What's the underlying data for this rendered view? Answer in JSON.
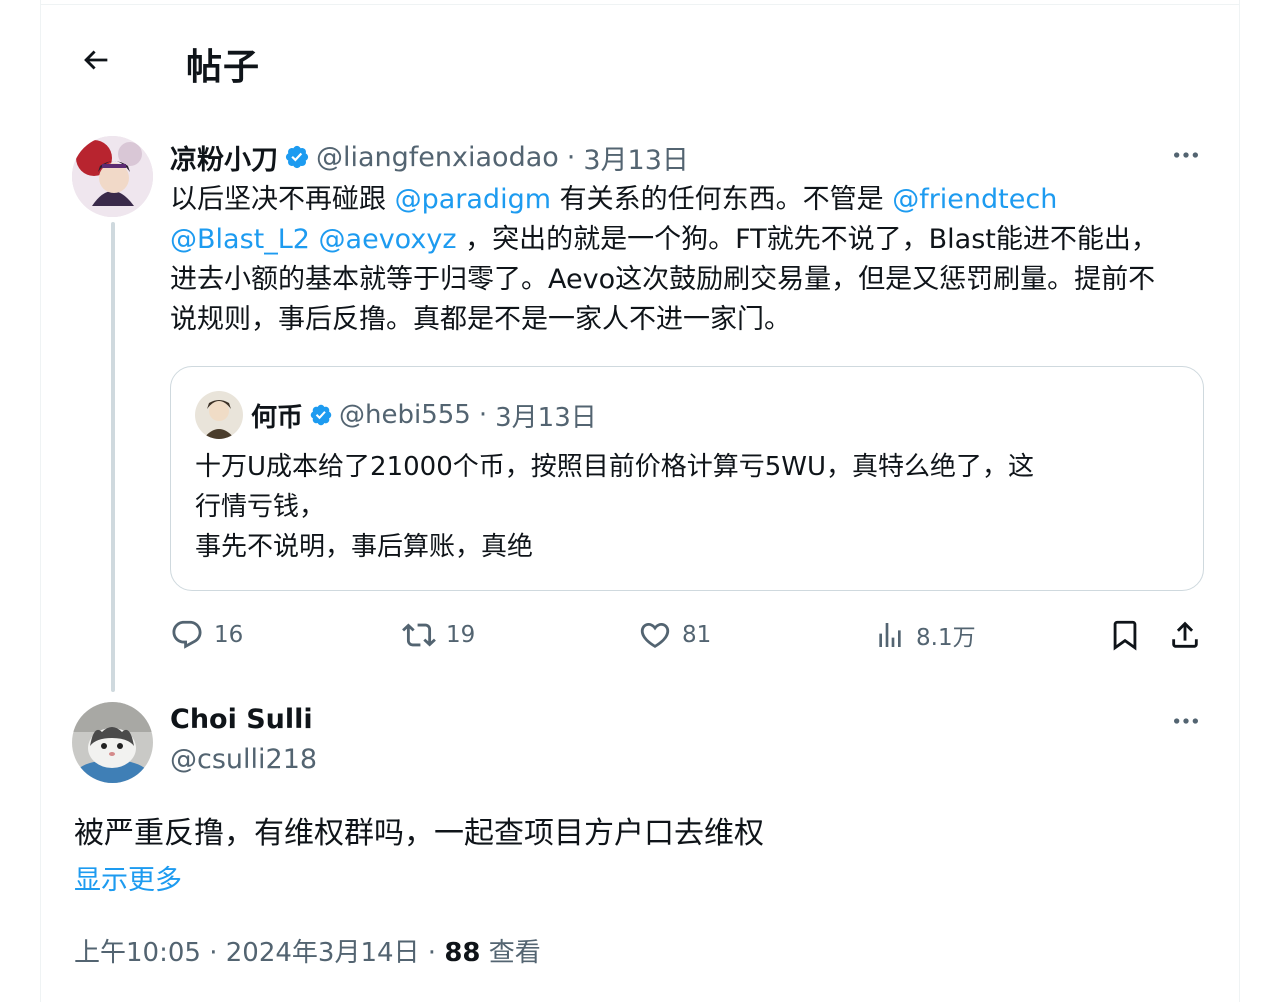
{
  "header": {
    "title": "帖子"
  },
  "post": {
    "author_name": "凉粉小刀",
    "handle": "@liangfenxiaodao",
    "separator": "·",
    "date": "3月13日",
    "segments": {
      "s1": "以后坚决不再碰跟 ",
      "m1": "@paradigm",
      "s2": " 有关系的任何东西。不管是 ",
      "m2": "@friendtech",
      "m3": "@Blast_L2",
      "s3": " ",
      "m4": "@aevoxyz",
      "s4": " ，突出的就是一个狗。FT就先不说了，Blast能进不能出，进去小额的基本就等于归零了。Aevo这次鼓励刷交易量，但是又惩罚刷量。提前不说规则，事后反撸。真都是不是一家人不进一家门。"
    },
    "quote": {
      "author_name": "何币",
      "handle": "@hebi555",
      "separator": "·",
      "date": "3月13日",
      "line1": "十万U成本给了21000个币，按照目前价格计算亏5WU，真特么绝了，这",
      "line2": "行情亏钱，",
      "line3": "事先不说明，事后算账，真绝"
    },
    "stats": {
      "replies": "16",
      "reposts": "19",
      "likes": "81",
      "views": "8.1万"
    }
  },
  "reply": {
    "author_name": "Choi Sulli",
    "handle": "@csulli218",
    "text": "被严重反撸，有维权群吗，一起查项目方户口去维权",
    "show_more": "显示更多",
    "meta": {
      "time": "上午10:05",
      "sep1": " · ",
      "date": "2024年3月14日",
      "sep2": " · ",
      "views": "88",
      "views_label": " 查看"
    }
  },
  "colors": {
    "accent": "#1d9bf0",
    "text": "#0f1419",
    "muted": "#536471",
    "border": "#cfd9de"
  },
  "icons": [
    "back-arrow-icon",
    "verified-badge-icon",
    "more-icon",
    "reply-icon",
    "repost-icon",
    "like-icon",
    "views-icon",
    "bookmark-icon",
    "share-icon"
  ]
}
